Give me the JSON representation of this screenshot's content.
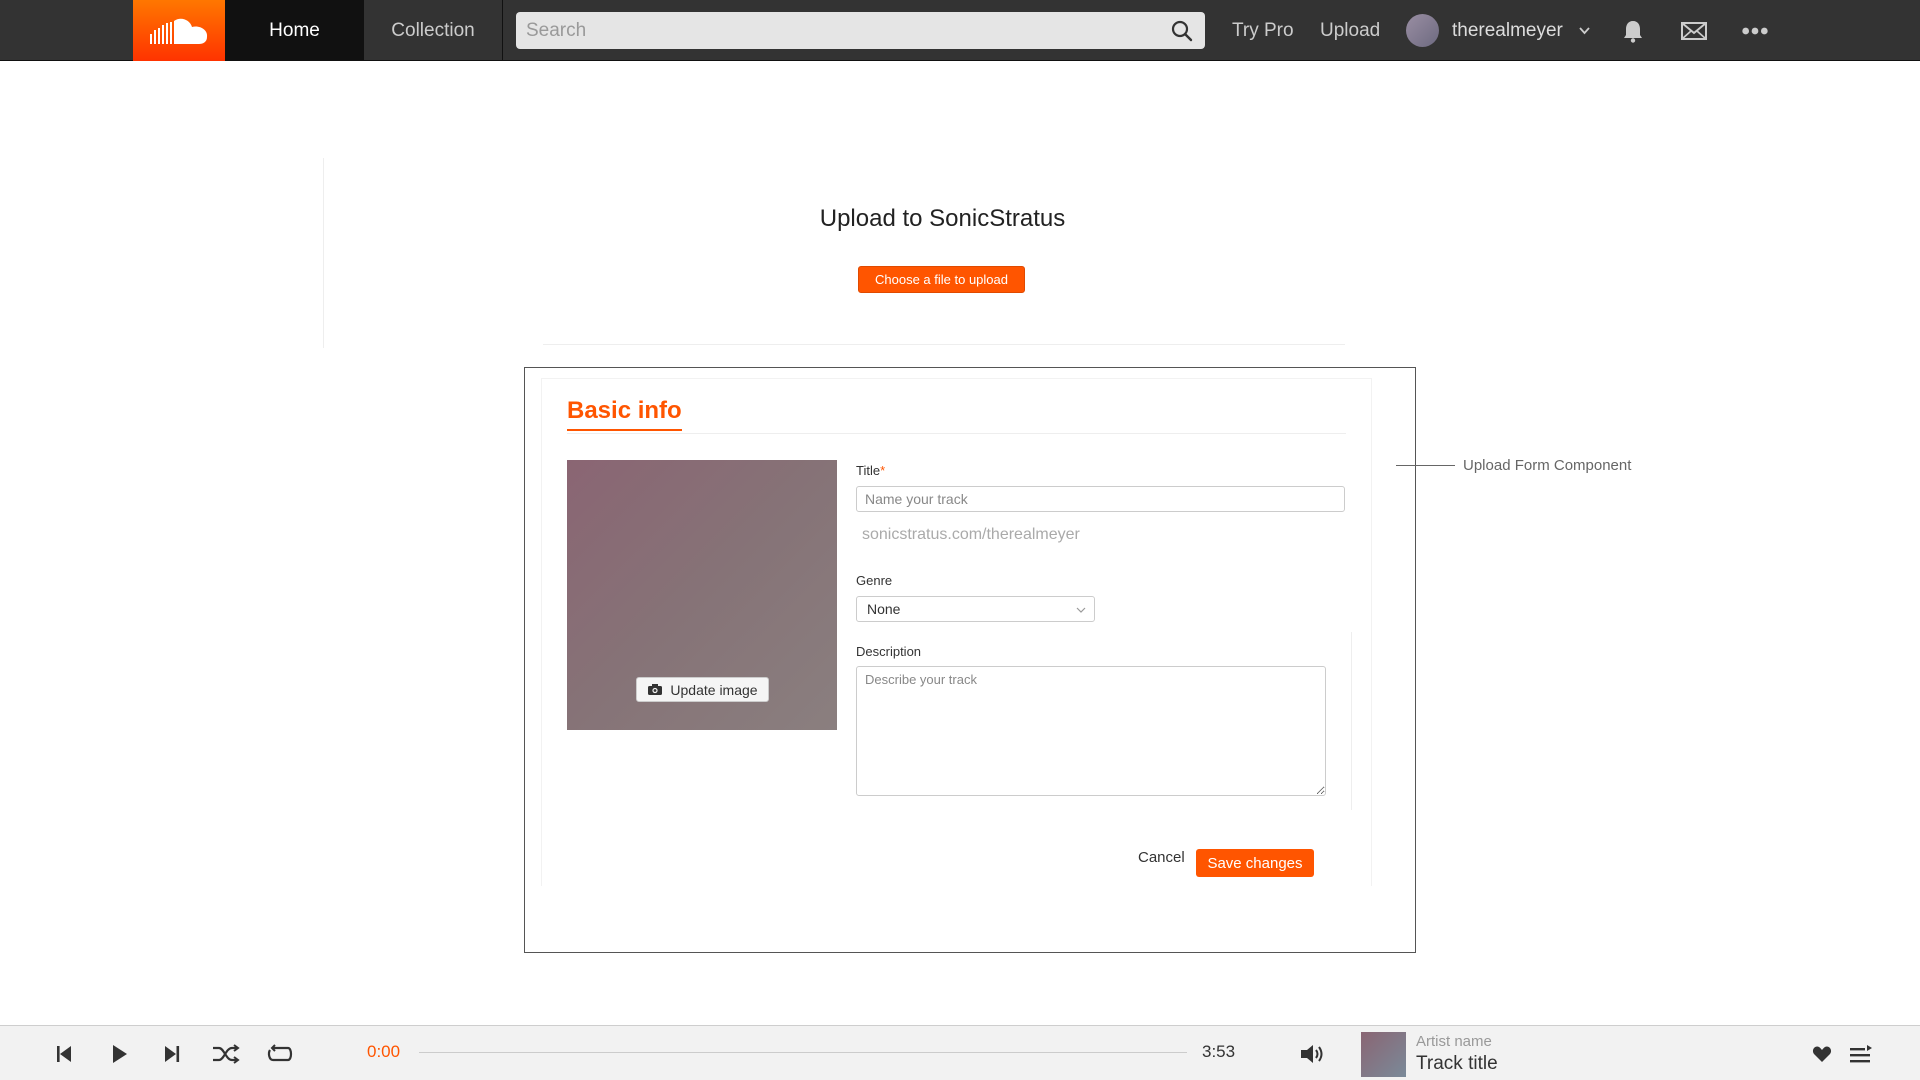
{
  "nav": {
    "home": "Home",
    "collection": "Collection",
    "search_placeholder": "Search",
    "try_pro": "Try Pro",
    "upload": "Upload",
    "username": "therealmeyer",
    "icons": [
      "soundcloud-logo-icon",
      "search-icon",
      "chevron-down-icon",
      "bell-icon",
      "mail-icon",
      "more-icon"
    ]
  },
  "upload": {
    "title": "Upload to SonicStratus",
    "choose_button": "Choose a file to upload"
  },
  "form": {
    "section_title": "Basic info",
    "update_image": "Update image",
    "title_label": "Title",
    "required_mark": "*",
    "title_placeholder": "Name your track",
    "permalink": "sonicstratus.com/therealmeyer",
    "genre_label": "Genre",
    "genre_value": "None",
    "description_label": "Description",
    "description_placeholder": "Describe your track",
    "cancel": "Cancel",
    "save": "Save changes"
  },
  "annotation": {
    "label": "Upload Form Component"
  },
  "player": {
    "current_time": "0:00",
    "duration": "3:53",
    "progress": 0,
    "artist": "Artist name",
    "track": "Track title",
    "icons": [
      "skip-back-icon",
      "play-icon",
      "skip-forward-icon",
      "shuffle-icon",
      "repeat-icon",
      "volume-icon",
      "heart-icon",
      "queue-icon"
    ]
  },
  "colors": {
    "accent": "#ff5500",
    "topbar": "#333333",
    "player_bg": "#f2f2f2"
  }
}
